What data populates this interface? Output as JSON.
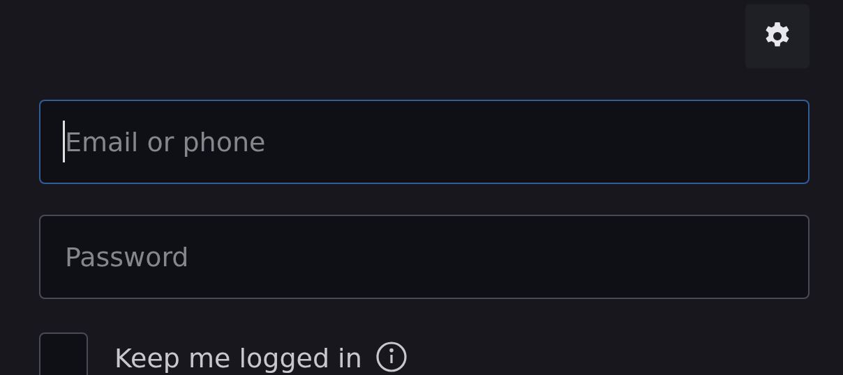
{
  "settings_button": {
    "kind": "gear"
  },
  "fields": [
    {
      "placeholder": "Email or phone",
      "focused": true
    },
    {
      "placeholder": "Password",
      "focused": false
    }
  ],
  "keep_logged_in": {
    "label": "Keep me logged in",
    "checked": false
  }
}
